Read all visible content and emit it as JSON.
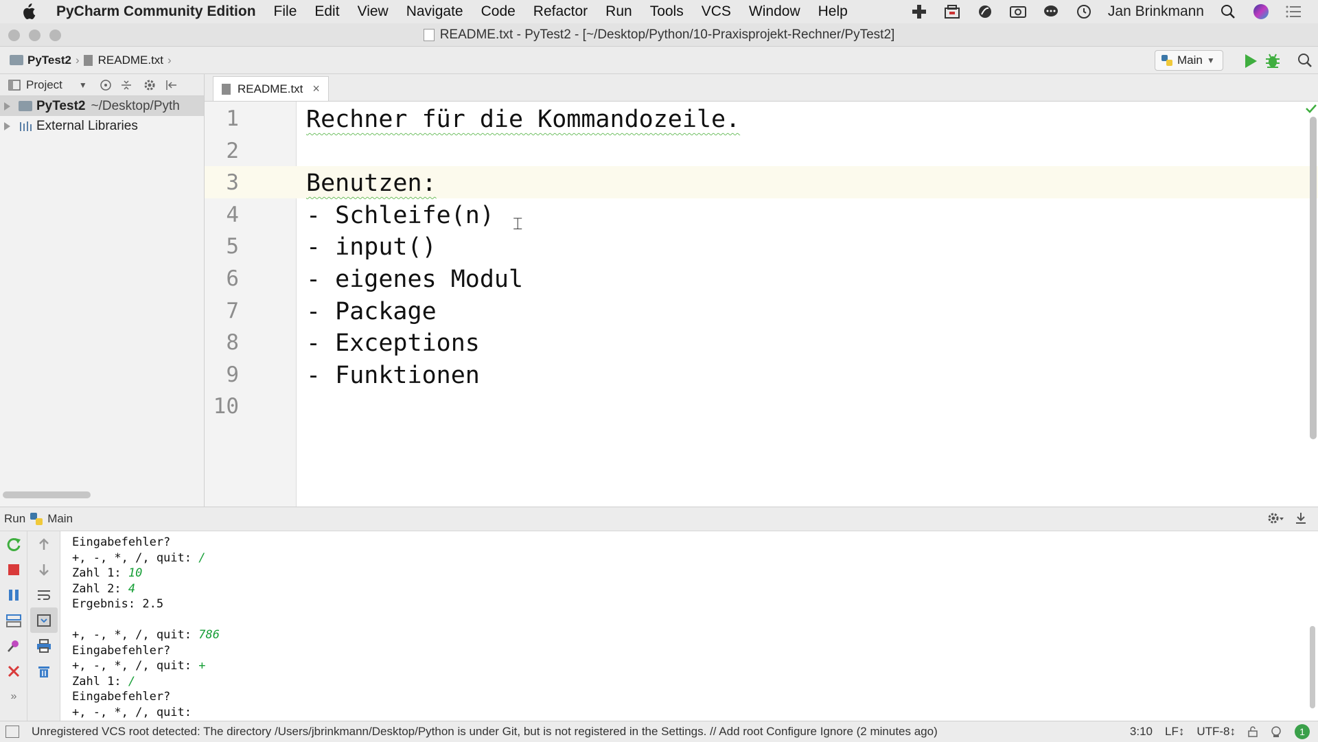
{
  "menubar": {
    "app_name": "PyCharm Community Edition",
    "items": [
      "File",
      "Edit",
      "View",
      "Navigate",
      "Code",
      "Refactor",
      "Run",
      "Tools",
      "VCS",
      "Window",
      "Help"
    ],
    "user": "Jan Brinkmann"
  },
  "window": {
    "title": "README.txt - PyTest2 - [~/Desktop/Python/10-Praxisprojekt-Rechner/PyTest2]"
  },
  "navbar": {
    "breadcrumb_project": "PyTest2",
    "breadcrumb_file": "README.txt",
    "run_config": "Main"
  },
  "project_panel": {
    "view_label": "Project",
    "tree": [
      {
        "name": "PyTest2",
        "path": "~/Desktop/Pyth"
      },
      {
        "name": "External Libraries"
      }
    ]
  },
  "editor": {
    "tab_label": "README.txt",
    "lines": [
      {
        "num": "1",
        "text": "Rechner für die Kommandozeile."
      },
      {
        "num": "2",
        "text": ""
      },
      {
        "num": "3",
        "text": "Benutzen:"
      },
      {
        "num": "4",
        "text": "- Schleife(n)"
      },
      {
        "num": "5",
        "text": "- input()"
      },
      {
        "num": "6",
        "text": "- eigenes Modul"
      },
      {
        "num": "7",
        "text": "- Package"
      },
      {
        "num": "8",
        "text": "- Exceptions"
      },
      {
        "num": "9",
        "text": "- Funktionen"
      },
      {
        "num": "10",
        "text": ""
      }
    ]
  },
  "run_panel": {
    "label": "Run",
    "config": "Main",
    "console": [
      {
        "text": "Eingabefehler?",
        "input": ""
      },
      {
        "text": "+, -, *, /, quit: ",
        "input": "/"
      },
      {
        "text": "Zahl 1: ",
        "input": "10"
      },
      {
        "text": "Zahl 2: ",
        "input": "4"
      },
      {
        "text": "Ergebnis: 2.5",
        "input": ""
      },
      {
        "text": "",
        "input": ""
      },
      {
        "text": "+, -, *, /, quit: ",
        "input": "786"
      },
      {
        "text": "Eingabefehler?",
        "input": ""
      },
      {
        "text": "+, -, *, /, quit: ",
        "input": "+"
      },
      {
        "text": "Zahl 1: ",
        "input": "/"
      },
      {
        "text": "Eingabefehler?",
        "input": ""
      },
      {
        "text": "+, -, *, /, quit:",
        "input": ""
      }
    ]
  },
  "statusbar": {
    "message": "Unregistered VCS root detected: The directory /Users/jbrinkmann/Desktop/Python is under Git, but is not registered in the Settings. // Add root  Configure  Ignore (2 minutes ago)",
    "position": "3:10",
    "line_sep": "LF↕",
    "encoding": "UTF-8↕",
    "badge": "1"
  },
  "colors": {
    "run_green": "#3fae3f",
    "stop_red": "#d93a3a",
    "console_input": "#159e35",
    "spell_wave": "#6fbf62"
  }
}
